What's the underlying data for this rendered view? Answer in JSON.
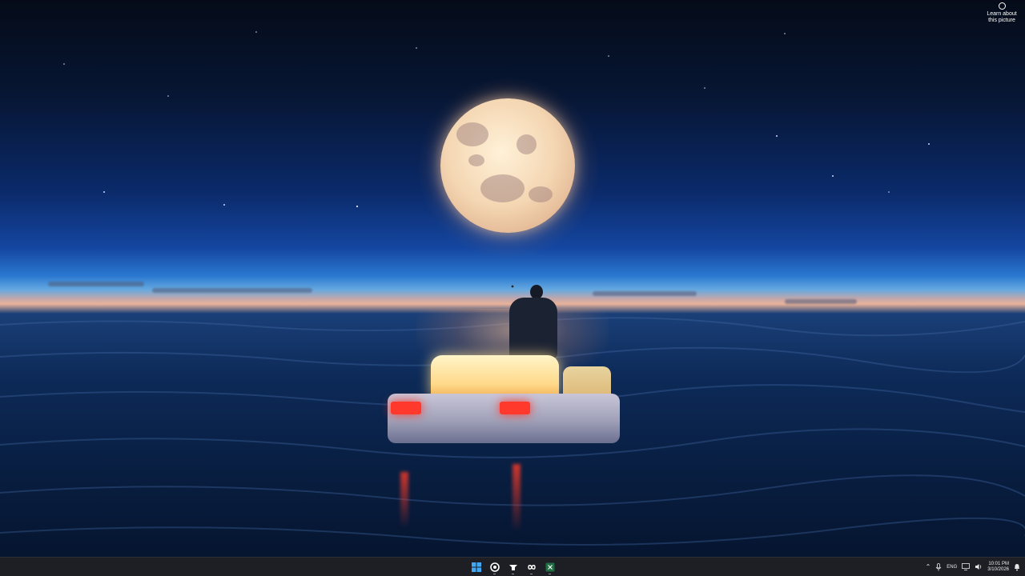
{
  "wallpaper": {
    "description_icon": "camera-icon",
    "attribution_line1": "Learn about",
    "attribution_line2": "this picture"
  },
  "taskbar": {
    "apps": [
      {
        "name": "start-button",
        "icon": "windows-logo-icon"
      },
      {
        "name": "taskbar-app-1",
        "icon": "circular-app-icon"
      },
      {
        "name": "taskbar-app-2",
        "icon": "anvil-app-icon"
      },
      {
        "name": "taskbar-app-3",
        "icon": "infinity-app-icon"
      },
      {
        "name": "taskbar-app-4",
        "icon": "excel-icon"
      }
    ],
    "tray": {
      "language": "ENG",
      "time": "10:01 PM",
      "date": "3/10/2026"
    }
  },
  "colors": {
    "taskbar_bg": "#1d1f24",
    "moon": "#f4d6b2",
    "tail_light": "#ff3a2d"
  }
}
